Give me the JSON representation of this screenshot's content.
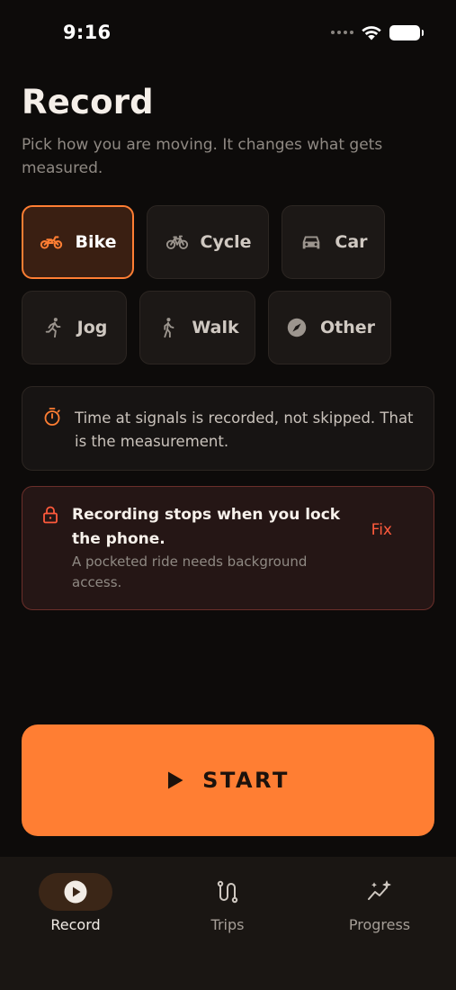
{
  "status": {
    "time": "9:16"
  },
  "header": {
    "title": "Record",
    "subtitle": "Pick how you are moving. It changes what gets measured."
  },
  "modes": [
    {
      "label": "Bike",
      "icon": "motorbike-icon",
      "selected": true
    },
    {
      "label": "Cycle",
      "icon": "bicycle-icon",
      "selected": false
    },
    {
      "label": "Car",
      "icon": "car-icon",
      "selected": false
    },
    {
      "label": "Jog",
      "icon": "runner-icon",
      "selected": false
    },
    {
      "label": "Walk",
      "icon": "walker-icon",
      "selected": false
    },
    {
      "label": "Other",
      "icon": "compass-icon",
      "selected": false
    }
  ],
  "info": {
    "icon": "stopwatch-icon",
    "text": "Time at signals is recorded, not skipped. That is the measurement."
  },
  "warning": {
    "icon": "lock-icon",
    "title": "Recording stops when you lock the phone.",
    "description": "A pocketed ride needs background access.",
    "action_label": "Fix"
  },
  "start": {
    "label": "START",
    "icon": "play-icon"
  },
  "tabs": [
    {
      "label": "Record",
      "icon": "play-circle-icon",
      "active": true
    },
    {
      "label": "Trips",
      "icon": "route-icon",
      "active": false
    },
    {
      "label": "Progress",
      "icon": "trend-sparkle-icon",
      "active": false
    }
  ],
  "colors": {
    "accent": "#ff7e33",
    "background": "#0d0b0a",
    "warning": "#ff5a3c",
    "selected_chip_bg": "#3a1f12"
  }
}
